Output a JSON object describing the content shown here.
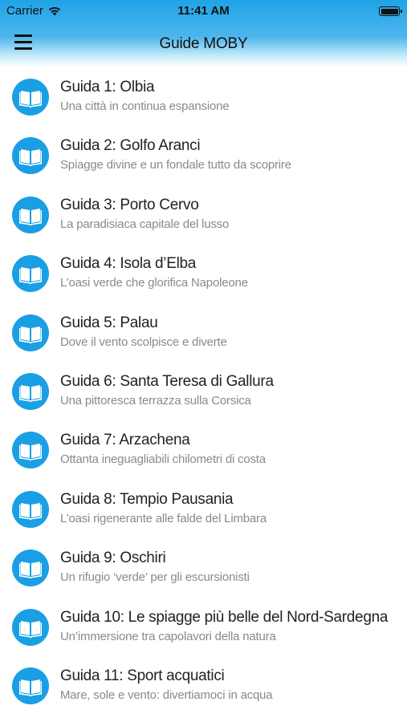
{
  "status_bar": {
    "carrier": "Carrier",
    "time": "11:41 AM"
  },
  "nav": {
    "title": "Guide MOBY",
    "menu_icon": "hamburger-menu-icon"
  },
  "colors": {
    "accent": "#1a9fe4",
    "header_top": "#1fa3e6",
    "title_text": "#222222",
    "subtitle_text": "#8a8a8a"
  },
  "guides": [
    {
      "title": "Guida 1: Olbia",
      "subtitle": "Una città in continua espansione",
      "icon": "book-icon"
    },
    {
      "title": "Guida 2: Golfo Aranci",
      "subtitle": "Spiagge divine e un fondale tutto da scoprire",
      "icon": "book-icon"
    },
    {
      "title": "Guida 3: Porto Cervo",
      "subtitle": "La paradisiaca capitale del lusso",
      "icon": "book-icon"
    },
    {
      "title": "Guida 4: Isola d’Elba",
      "subtitle": "L’oasi verde che glorifica Napoleone",
      "icon": "book-icon"
    },
    {
      "title": "Guida 5: Palau",
      "subtitle": "Dove il vento scolpisce e diverte",
      "icon": "book-icon"
    },
    {
      "title": "Guida 6: Santa Teresa di Gallura",
      "subtitle": "Una pittoresca terrazza sulla Corsica",
      "icon": "book-icon"
    },
    {
      "title": "Guida 7: Arzachena",
      "subtitle": "Ottanta ineguagliabili chilometri di costa",
      "icon": "book-icon"
    },
    {
      "title": "Guida 8: Tempio Pausania",
      "subtitle": "L’oasi rigenerante alle falde del Limbara",
      "icon": "book-icon"
    },
    {
      "title": "Guida 9: Oschiri",
      "subtitle": "Un rifugio ‘verde’ per gli escursionisti",
      "icon": "book-icon"
    },
    {
      "title": "Guida 10: Le spiagge più belle del Nord-Sardegna",
      "subtitle": "Un’immersione tra capolavori della natura",
      "icon": "book-icon"
    },
    {
      "title": "Guida 11: Sport acquatici",
      "subtitle": "Mare, sole e vento: divertiamoci in acqua",
      "icon": "book-icon"
    }
  ]
}
